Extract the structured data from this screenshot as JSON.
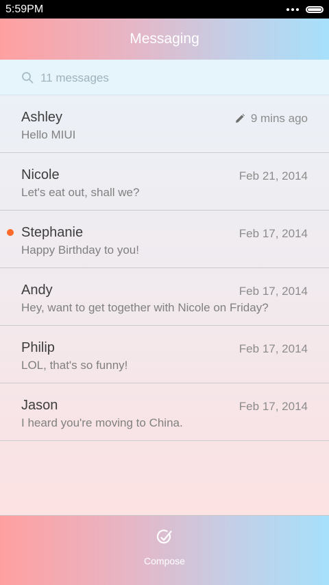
{
  "status_bar": {
    "time": "5:59PM"
  },
  "header": {
    "title": "Messaging"
  },
  "search": {
    "text": "11 messages"
  },
  "conversations": [
    {
      "name": "Ashley",
      "preview": "Hello MIUI",
      "date": "9 mins ago",
      "draft": true,
      "unread": false
    },
    {
      "name": "Nicole",
      "preview": "Let's eat out, shall we?",
      "date": "Feb 21, 2014",
      "draft": false,
      "unread": false
    },
    {
      "name": "Stephanie",
      "preview": "Happy Birthday to you!",
      "date": "Feb 17, 2014",
      "draft": false,
      "unread": true
    },
    {
      "name": "Andy",
      "preview": "Hey, want to get together with Nicole on Friday?",
      "date": "Feb 17, 2014",
      "draft": false,
      "unread": false
    },
    {
      "name": "Philip",
      "preview": "LOL, that's so funny!",
      "date": "Feb 17, 2014",
      "draft": false,
      "unread": false
    },
    {
      "name": "Jason",
      "preview": "I heard you're moving to China.",
      "date": "Feb 17, 2014",
      "draft": false,
      "unread": false
    }
  ],
  "bottom_bar": {
    "compose_label": "Compose"
  },
  "colors": {
    "unread_dot": "#ff6a2b",
    "header_gradient_start": "#ffa0a0",
    "header_gradient_end": "#a6e0fb"
  }
}
